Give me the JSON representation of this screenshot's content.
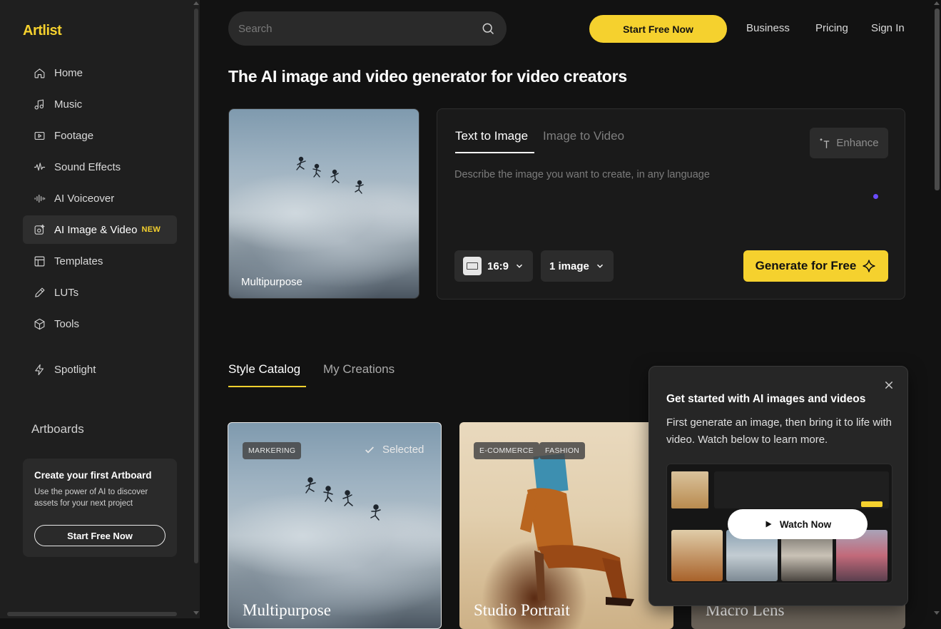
{
  "brand": {
    "logo": "Artlist",
    "accent": "#f5d12e"
  },
  "sidebar": {
    "items": [
      {
        "label": "Home",
        "icon": "home-icon"
      },
      {
        "label": "Music",
        "icon": "music-note-icon"
      },
      {
        "label": "Footage",
        "icon": "play-box-icon"
      },
      {
        "label": "Sound Effects",
        "icon": "waveform-icon"
      },
      {
        "label": "AI Voiceover",
        "icon": "voice-bars-icon"
      },
      {
        "label": "AI Image & Video",
        "icon": "ai-image-icon",
        "badge": "NEW",
        "active": true
      },
      {
        "label": "Templates",
        "icon": "template-icon"
      },
      {
        "label": "LUTs",
        "icon": "dropper-icon"
      },
      {
        "label": "Tools",
        "icon": "cube-icon"
      },
      {
        "label": "Spotlight",
        "icon": "lightning-icon"
      }
    ],
    "artboards_title": "Artboards",
    "artboard_card": {
      "title": "Create your first Artboard",
      "text": "Use the power of AI to discover assets for your next project",
      "button": "Start Free Now"
    }
  },
  "header": {
    "search_placeholder": "Search",
    "cta": "Start Free Now",
    "links": [
      "Business",
      "Pricing",
      "Sign In"
    ]
  },
  "page_title": "The AI image and video generator for video creators",
  "preview": {
    "caption": "Multipurpose"
  },
  "generator": {
    "tabs": [
      "Text to Image",
      "Image to Video"
    ],
    "enhance": "Enhance",
    "prompt_placeholder": "Describe the image you want to create, in any language",
    "ratio": "16:9",
    "count": "1 image",
    "generate": "Generate for Free"
  },
  "catalog": {
    "tabs": [
      "Style Catalog",
      "My Creations"
    ],
    "selected_label": "Selected",
    "cards": [
      {
        "title": "Multipurpose",
        "tags": [
          "MARKERING"
        ]
      },
      {
        "title": "Studio Portrait",
        "tags": [
          "E-COMMERCE",
          "FASHION"
        ]
      },
      {
        "title": "Macro Lens",
        "tags": []
      }
    ]
  },
  "popover": {
    "title": "Get started with AI images and videos",
    "text": "First generate an image, then bring it to life with video. Watch below to learn more.",
    "button": "Watch Now"
  }
}
